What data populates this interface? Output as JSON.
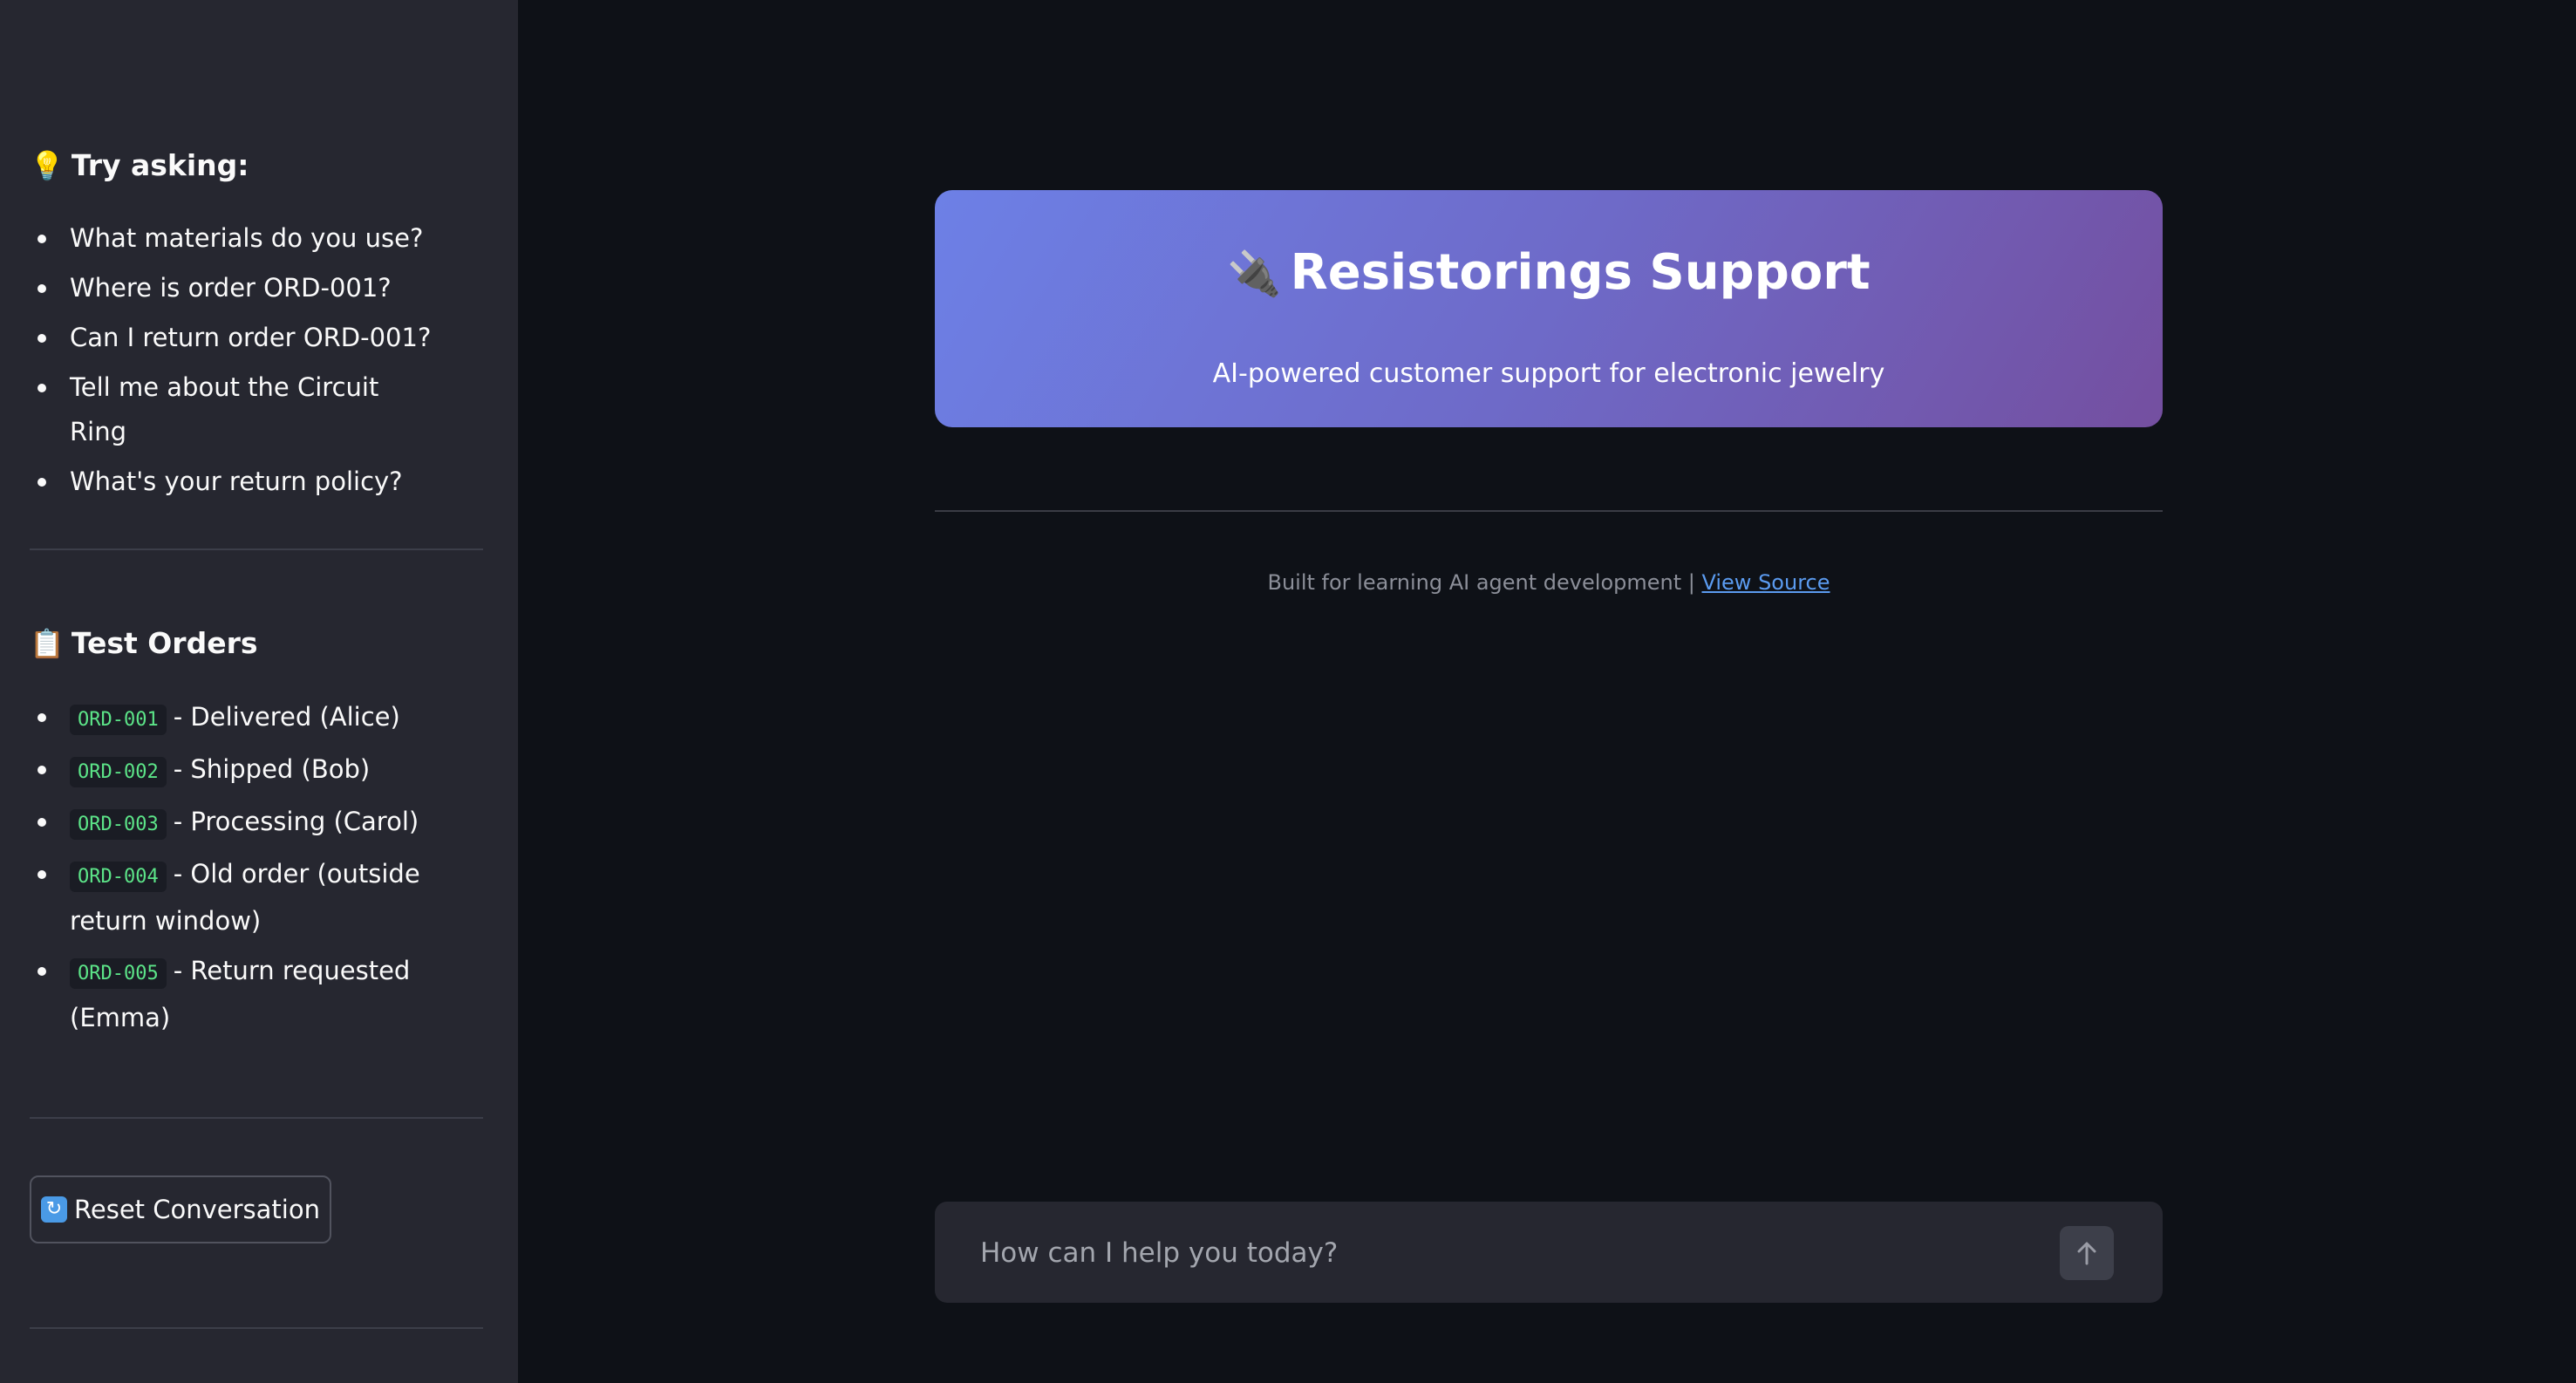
{
  "sidebar": {
    "try_asking": {
      "icon": "lightbulb-icon",
      "title": "Try asking:",
      "items": [
        "What materials do you use?",
        "Where is order ORD-001?",
        "Can I return order ORD-001?",
        "Tell me about the Circuit Ring",
        "What's your return policy?"
      ]
    },
    "test_orders": {
      "icon": "clipboard-icon",
      "title": "Test Orders",
      "items": [
        {
          "code": "ORD-001",
          "text": "- Delivered (Alice)"
        },
        {
          "code": "ORD-002",
          "text": "- Shipped (Bob)"
        },
        {
          "code": "ORD-003",
          "text": "- Processing (Carol)"
        },
        {
          "code": "ORD-004",
          "text": "- Old order (outside return window)"
        },
        {
          "code": "ORD-005",
          "text": "- Return requested (Emma)"
        }
      ]
    },
    "reset_button": {
      "icon": "refresh-icon",
      "label": "Reset Conversation"
    }
  },
  "hero": {
    "icon": "plug-icon",
    "title": "Resistorings Support",
    "subtitle": "AI-powered customer support for electronic jewelry"
  },
  "footer": {
    "text": "Built for learning AI agent development |",
    "link_label": "View Source"
  },
  "chat": {
    "placeholder": "How can I help you today?",
    "send_icon": "arrow-up-icon"
  },
  "colors": {
    "background": "#0e1117",
    "sidebar": "#262730",
    "hero_gradient_start": "#6d80e6",
    "hero_gradient_end": "#744fa0",
    "code_text": "#5ce488",
    "link": "#5b9bf0"
  }
}
